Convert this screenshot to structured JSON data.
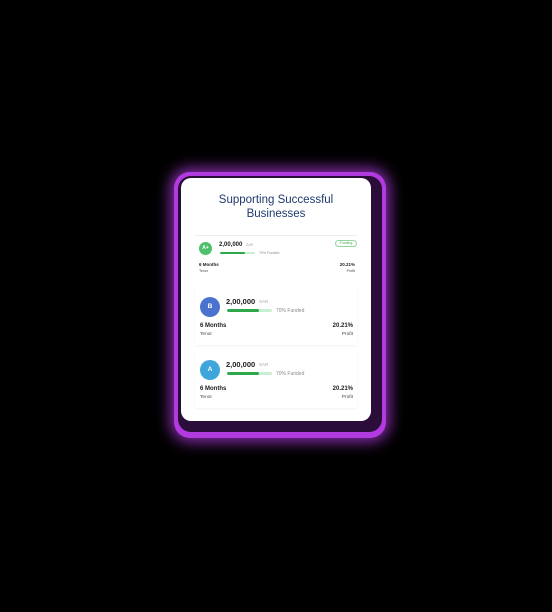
{
  "card": {
    "title_line1": "Supporting Successful",
    "title_line2": "Businesses"
  },
  "items": [
    {
      "grade": "A+",
      "grade_color": "#4cc06a",
      "amount": "2,00,000",
      "currency": "SAR",
      "funded_label": "70% Funded",
      "funded_fraction": 0.7,
      "status": "Funding",
      "tenor_value": "6 Months",
      "tenor_label": "Tenor",
      "profit_value": "20.21%",
      "profit_label": "Profit"
    },
    {
      "grade": "B",
      "grade_color": "#4a73cf",
      "amount": "2,00,000",
      "currency": "SAR",
      "funded_label": "70% Funded",
      "funded_fraction": 0.7,
      "tenor_value": "6 Months",
      "tenor_label": "Tenor",
      "profit_value": "20.21%",
      "profit_label": "Profit"
    },
    {
      "grade": "A",
      "grade_color": "#3fa6dc",
      "amount": "2,00,000",
      "currency": "SAR",
      "funded_label": "70% Funded",
      "funded_fraction": 0.7,
      "tenor_value": "6 Months",
      "tenor_label": "Tenor",
      "profit_value": "20.21%",
      "profit_label": "Profit"
    }
  ],
  "colors": {
    "glow": "#b23be0",
    "title": "#1e3a6e",
    "progress_fill": "#2fa84a",
    "progress_track": "#c9efd2"
  }
}
